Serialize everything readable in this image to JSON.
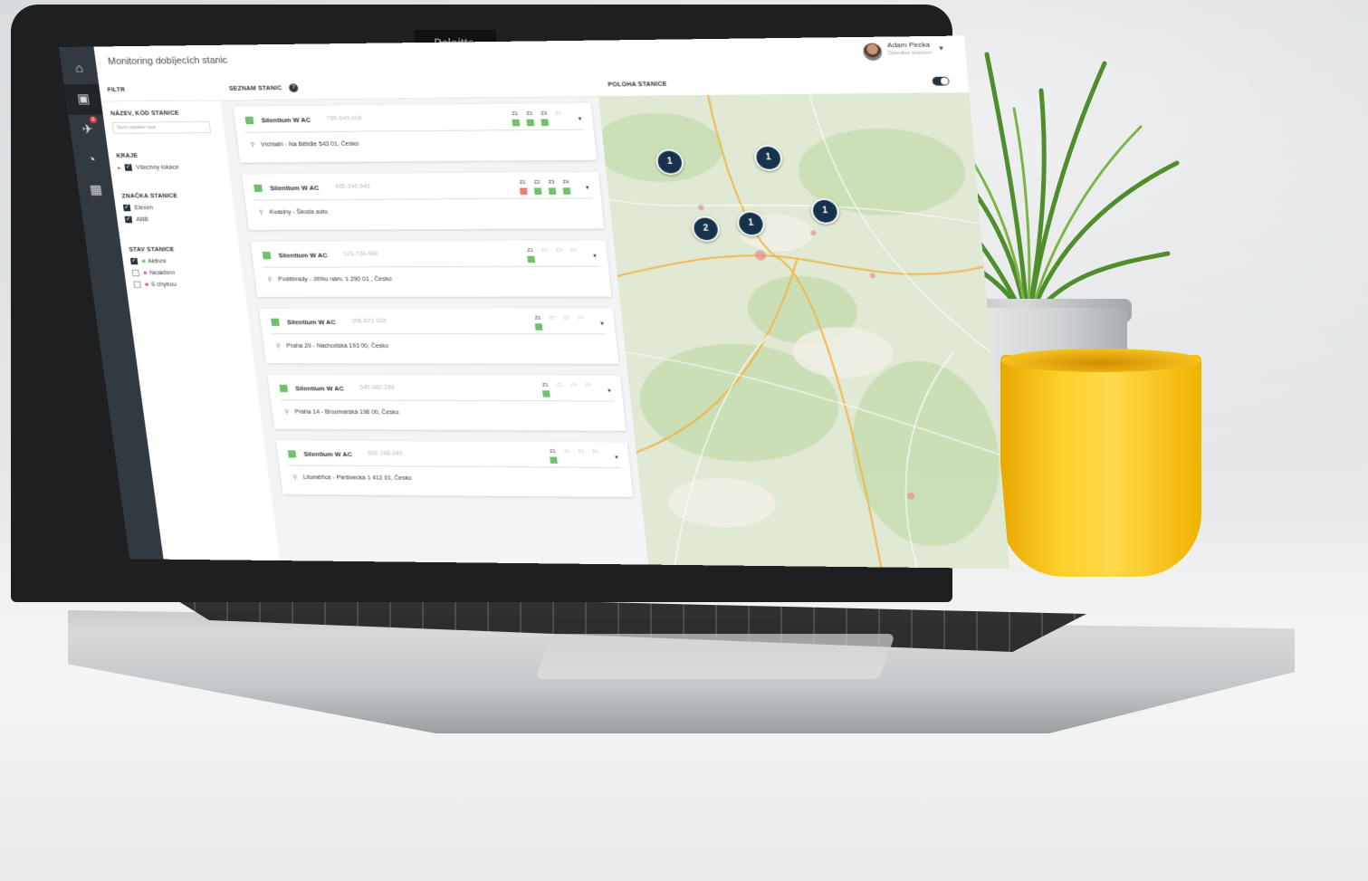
{
  "brand": "Deloitte.",
  "app": {
    "title": "Monitoring dobíjecích stanic",
    "user": {
      "name": "Adam Pecka",
      "role": "Operátor provozu"
    }
  },
  "rail_icons": [
    "home-icon",
    "station-icon",
    "alerts-icon",
    "chart-icon",
    "table-icon"
  ],
  "rail_badge": "2",
  "filter": {
    "heading": "FILTR",
    "name_section": "NÁZEV, KÓD STANICE",
    "search_placeholder": "Sem napište text",
    "region_section": "KRAJE",
    "regions": [
      {
        "label": "Všechny lokace",
        "checked": true
      }
    ],
    "brand_section": "ZNAČKA STANICE",
    "brands": [
      {
        "label": "Elexim",
        "checked": true
      },
      {
        "label": "ABB",
        "checked": true
      }
    ],
    "state_section": "STAV STANICE",
    "states": [
      {
        "label": "Aktivní",
        "checked": true,
        "color": "#6fc26b"
      },
      {
        "label": "Neaktivní",
        "checked": false,
        "color": "#c56bd6"
      },
      {
        "label": "S chybou",
        "checked": false,
        "color": "#ef5b5b"
      }
    ]
  },
  "list": {
    "heading": "SEZNAM STANIC",
    "help": "?",
    "connector_labels": [
      "Z1",
      "Z2",
      "Z3",
      "Z4"
    ],
    "stations": [
      {
        "name": "Silentium W AC",
        "code": "789-549-009",
        "address": "Vrchlabí - Na Bělidle 543 01, Česko",
        "connectors": [
          "green",
          "green",
          "green",
          "none"
        ]
      },
      {
        "name": "Silentium W AC",
        "code": "485-549-549",
        "address": "Kvasiny - Škoda auto",
        "connectors": [
          "red",
          "green",
          "green",
          "green"
        ]
      },
      {
        "name": "Silentium W AC",
        "code": "123-734-980",
        "address": "Poděbrady - Jiřího nám. 1 290 01 , Česko",
        "connectors": [
          "green",
          "none",
          "none",
          "none"
        ]
      },
      {
        "name": "Silentium W AC",
        "code": "356-872-923",
        "address": "Praha 20 - Náchodská 193 00, Česko",
        "connectors": [
          "green",
          "none",
          "none",
          "none"
        ]
      },
      {
        "name": "Silentium W AC",
        "code": "545-982-284",
        "address": "Praha 14 - Broumarská 198 00, Česko",
        "connectors": [
          "green",
          "none",
          "none",
          "none"
        ]
      },
      {
        "name": "Silentium W AC",
        "code": "502-248-249",
        "address": "Litoměřice - Plešivecká 1 412 01, Česko",
        "connectors": [
          "green",
          "none",
          "none",
          "none"
        ]
      }
    ]
  },
  "map": {
    "heading": "POLOHA STANICE",
    "clusters": [
      "1",
      "1",
      "2",
      "1",
      "1"
    ]
  },
  "colors": {
    "rail": "#323a41",
    "accent_dark": "#17324a",
    "status_green": "#6fc26b",
    "status_red": "#ef7a73"
  }
}
